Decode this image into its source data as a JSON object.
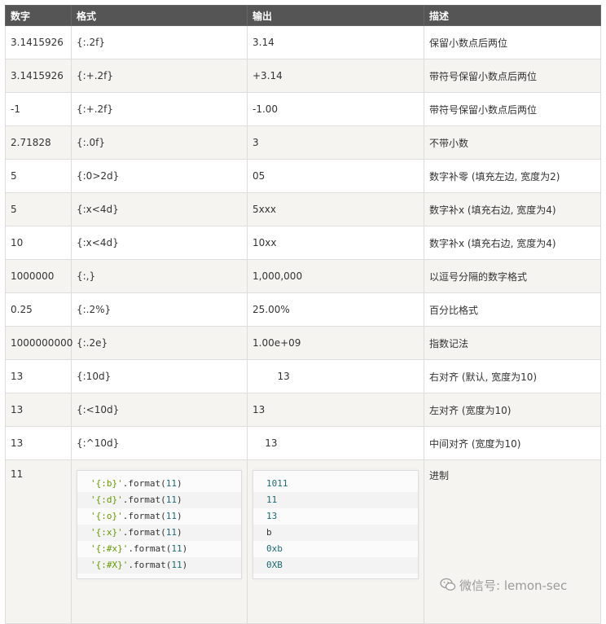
{
  "headers": [
    "数字",
    "格式",
    "输出",
    "描述"
  ],
  "rows": [
    {
      "number": "3.1415926",
      "format": "{:.2f}",
      "output": "3.14",
      "desc": "保留小数点后两位"
    },
    {
      "number": "3.1415926",
      "format": "{:+.2f}",
      "output": "+3.14",
      "desc": "带符号保留小数点后两位"
    },
    {
      "number": "-1",
      "format": "{:+.2f}",
      "output": "-1.00",
      "desc": "带符号保留小数点后两位"
    },
    {
      "number": "2.71828",
      "format": "{:.0f}",
      "output": "3",
      "desc": "不带小数"
    },
    {
      "number": "5",
      "format": "{:0>2d}",
      "output": "05",
      "desc": "数字补零 (填充左边, 宽度为2)"
    },
    {
      "number": "5",
      "format": "{:x<4d}",
      "output": "5xxx",
      "desc": "数字补x (填充右边, 宽度为4)"
    },
    {
      "number": "10",
      "format": "{:x<4d}",
      "output": "10xx",
      "desc": "数字补x (填充右边, 宽度为4)"
    },
    {
      "number": "1000000",
      "format": "{:,}",
      "output": "1,000,000",
      "desc": "以逗号分隔的数字格式"
    },
    {
      "number": "0.25",
      "format": "{:.2%}",
      "output": "25.00%",
      "desc": "百分比格式"
    },
    {
      "number": "1000000000",
      "format": "{:.2e}",
      "output": "1.00e+09",
      "desc": "指数记法"
    },
    {
      "number": "13",
      "format": "{:10d}",
      "output": "        13",
      "desc": "右对齐 (默认, 宽度为10)"
    },
    {
      "number": "13",
      "format": "{:<10d}",
      "output": "13",
      "desc": "左对齐 (宽度为10)"
    },
    {
      "number": "13",
      "format": "{:^10d}",
      "output": "    13",
      "desc": "中间对齐 (宽度为10)"
    }
  ],
  "last_row": {
    "number": "11",
    "desc": "进制",
    "code_lines": [
      {
        "str": "'{:b}'",
        "method": ".format(",
        "arg": "11",
        "close": ")"
      },
      {
        "str": "'{:d}'",
        "method": ".format(",
        "arg": "11",
        "close": ")"
      },
      {
        "str": "'{:o}'",
        "method": ".format(",
        "arg": "11",
        "close": ")"
      },
      {
        "str": "'{:x}'",
        "method": ".format(",
        "arg": "11",
        "close": ")"
      },
      {
        "str": "'{:#x}'",
        "method": ".format(",
        "arg": "11",
        "close": ")"
      },
      {
        "str": "'{:#X}'",
        "method": ".format(",
        "arg": "11",
        "close": ")"
      }
    ],
    "outputs": [
      "1011",
      "11",
      "13",
      "b",
      "0xb",
      "0XB"
    ]
  },
  "watermark": "微信号: lemon-sec"
}
